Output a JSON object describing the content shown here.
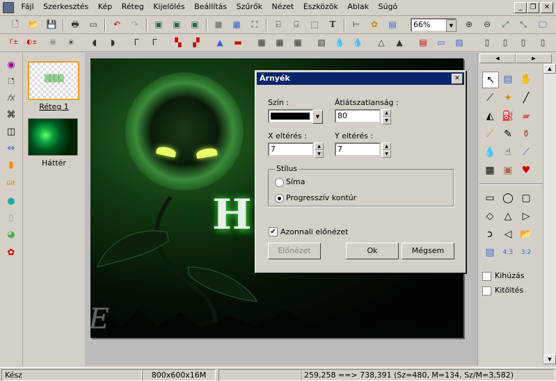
{
  "menu": {
    "items": [
      "Fájl",
      "Szerkesztés",
      "Kép",
      "Réteg",
      "Kijelölés",
      "Beállítás",
      "Szűrők",
      "Nézet",
      "Eszközök",
      "Ablak",
      "Súgó"
    ],
    "window_controls": [
      "_",
      "❐",
      "✕"
    ]
  },
  "toolbar": {
    "zoom_value": "66%"
  },
  "layers": {
    "items": [
      {
        "label": "Réteg 1",
        "selected": true
      },
      {
        "label": "Háttér",
        "selected": false
      }
    ]
  },
  "canvas": {
    "letter": "H",
    "watermark": "LNE",
    "colors": {
      "glow": "#37c837",
      "dark": "#0a1a0a"
    }
  },
  "dialog": {
    "title": "Árnyék",
    "close": "✕",
    "color_label": "Szín :",
    "opacity_label": "Átlátszatlanság :",
    "opacity_value": "80",
    "x_offset_label": "X eltérés :",
    "x_offset_value": "7",
    "y_offset_label": "Y eltérés :",
    "y_offset_value": "7",
    "style_group": "Stílus",
    "style_options": [
      {
        "label": "Síma",
        "checked": false
      },
      {
        "label": "Progresszív kontúr",
        "checked": true
      }
    ],
    "preview_checkbox_label": "Azonnali előnézet",
    "preview_checked": true,
    "preview_button": "Előnézet",
    "ok_button": "Ok",
    "cancel_button": "Mégsem"
  },
  "rightpanel": {
    "stroke_label": "Kihúzás",
    "fill_label": "Kitöltés"
  },
  "status": {
    "left": "Kész",
    "size": "800x600x16M",
    "coords": "259,258 ==> 738,391 (Sz=480, M=134, Sz/M=3,582)"
  }
}
